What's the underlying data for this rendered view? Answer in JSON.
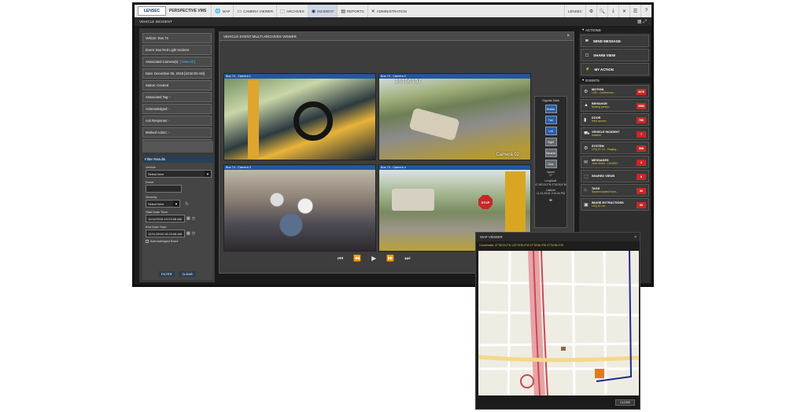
{
  "app": {
    "logo": "LENSEC",
    "brand": "PERSPECTIVE VMS"
  },
  "nav": {
    "tabs": [
      {
        "label": "MAP",
        "icon": "globe-icon"
      },
      {
        "label": "CAMERA VIEWER",
        "icon": "monitor-icon"
      },
      {
        "label": "ARCHIVES",
        "icon": "archive-icon"
      },
      {
        "label": "INCIDENT",
        "icon": "incident-icon",
        "active": true
      },
      {
        "label": "REPORTS",
        "icon": "reports-icon"
      },
      {
        "label": "ADMINISTRATION",
        "icon": "tools-icon"
      }
    ],
    "user": "LENSEC"
  },
  "page_title": "VEHICLE INCIDENT",
  "details": [
    {
      "text": "Vehicle: Bus 74"
    },
    {
      "text": "Event: Bus Red Light Incident"
    },
    {
      "text": "Associated Camera(s):",
      "link": "[ View All ]"
    },
    {
      "text": "Date: December 05, 2018 [10:50:00 AM]"
    },
    {
      "text": "Status: Created"
    },
    {
      "text": "Associated Tag: -"
    },
    {
      "text": "Acknowledged: -"
    },
    {
      "text": "Ack Response: -"
    },
    {
      "text": "Marked Action: -"
    },
    {
      "text": "Action Response: -"
    }
  ],
  "filter": {
    "title": "Filter Results",
    "vehicle_label": "Vehicle",
    "vehicle_value": "Select Item",
    "event_label": "Event",
    "severity_label": "Severity",
    "severity_value": "Select Item",
    "start_label": "Start Date Time",
    "start_value": "11/11/2018 10:23:08 AM",
    "end_label": "End Date Time",
    "end_value": "12/11/2018 10:23:08 AM",
    "ack_label": "Acknowledged Event",
    "filter_btn": "FILTER",
    "clear_btn": "CLEAR"
  },
  "multiview": {
    "title": "VEHICLE EVENT MULTI ARCHIVES VIEWER",
    "cameras": [
      {
        "label": "Bus 74 - Camera 1"
      },
      {
        "label": "Bus 74 - Camera 2",
        "timestamp": "16:56:57",
        "overlay": "Camera 02"
      },
      {
        "label": "Bus 74 - Camera 3"
      },
      {
        "label": "Bus 74 - Camera 4",
        "sign": "STOP"
      }
    ]
  },
  "gps": {
    "title": "Signals Data",
    "icons": [
      "Brakes",
      "Turn",
      "Left",
      "Right",
      "Hazards",
      "Door"
    ],
    "speed_label": "Speed",
    "speed_value": "27",
    "longitude_label": "Longitude",
    "longitude_value": "47.58°15.2°N 2°18'28.4°W",
    "latitude_label": "Latitude",
    "latitude_value": "11.24.2018, 2:10:44 PM"
  },
  "playback": {
    "controls": [
      "⏮",
      "⏪",
      "▶",
      "⏩",
      "⏭"
    ]
  },
  "actions": {
    "title": "ACTIONS",
    "items": [
      {
        "label": "SEND MESSAGE",
        "icon": "message-icon"
      },
      {
        "label": "SHARE VIEW",
        "icon": "share-icon"
      },
      {
        "label": "MY ACTION",
        "icon": "lightning-icon"
      }
    ]
  },
  "events": {
    "title": "EVENTS",
    "items": [
      {
        "name": "MOTION",
        "sub": "LOB - Conference...",
        "count": "4078",
        "icon": "motion-icon"
      },
      {
        "name": "BEHAVIOR",
        "sub": "Moving person...",
        "count": "3986",
        "icon": "warning-icon"
      },
      {
        "name": "DOOR",
        "sub": "Held access",
        "count": "786",
        "icon": "door-icon"
      },
      {
        "name": "VEHICLE INCIDENT",
        "sub": "Incident",
        "count": "7",
        "icon": "vehicle-icon"
      },
      {
        "name": "SYSTEM",
        "sub": "LHQ-01 14 - Staging...",
        "count": "508",
        "icon": "system-icon"
      },
      {
        "name": "MESSAGES",
        "sub": "John Smith - LENSEC",
        "count": "2",
        "icon": "mail-icon"
      },
      {
        "name": "SHARED VIEWS",
        "sub": "",
        "count": "8",
        "icon": "shared-icon"
      },
      {
        "name": "TAGS",
        "sub": "Student seated from...",
        "count": "30",
        "icon": "tag-icon"
      },
      {
        "name": "IMAGE EXTRACTIONS",
        "sub": "LHQ-01 mi...",
        "count": "60",
        "icon": "image-icon"
      }
    ]
  },
  "map": {
    "title": "MAP VIEWER",
    "coordinates": "Coordinates: 47°36'15.2°N 122°19'30.6°W 47°34'56.3°W 47°34'56.3°W",
    "close": "CLOSE"
  },
  "colors": {
    "accent": "#2456a0",
    "alert": "#c62828",
    "highlight": "#e2c93a"
  }
}
